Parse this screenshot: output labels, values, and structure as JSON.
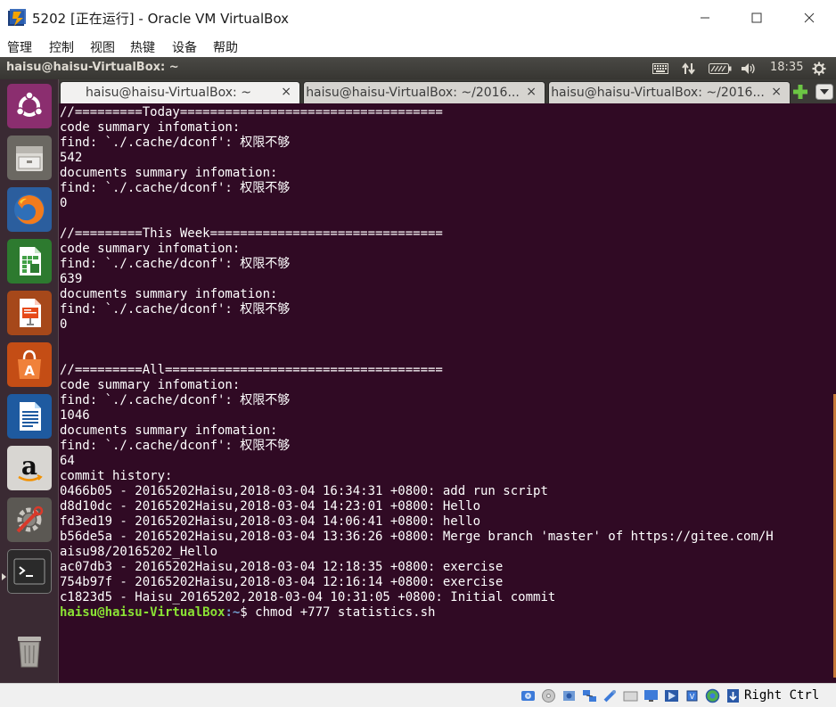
{
  "window": {
    "title": "5202 [正在运行] - Oracle VM VirtualBox",
    "minimize_glyph": "—",
    "maximize_glyph": "☐",
    "close_glyph": "✕"
  },
  "host_menu": [
    "管理",
    "控制",
    "视图",
    "热键",
    "设备",
    "帮助"
  ],
  "ubuntu_panel": {
    "title": "haisu@haisu-VirtualBox: ~",
    "clock": "18:35",
    "indicators": [
      "keyboard-icon",
      "network-transfer-icon",
      "battery-icon",
      "volume-icon",
      "power-gear-icon"
    ]
  },
  "launcher": {
    "items": [
      {
        "name": "ubuntu-dash-icon"
      },
      {
        "name": "files-icon"
      },
      {
        "name": "firefox-icon"
      },
      {
        "name": "libreoffice-calc-icon"
      },
      {
        "name": "libreoffice-impress-icon"
      },
      {
        "name": "software-center-icon"
      },
      {
        "name": "libreoffice-writer-icon"
      },
      {
        "name": "amazon-icon"
      },
      {
        "name": "system-settings-icon"
      },
      {
        "name": "terminal-icon"
      },
      {
        "name": "trash-icon"
      }
    ]
  },
  "tabs": [
    {
      "label": "haisu@haisu-VirtualBox: ~",
      "active": true
    },
    {
      "label": "haisu@haisu-VirtualBox: ~/2016...",
      "active": false
    },
    {
      "label": "haisu@haisu-VirtualBox: ~/2016...",
      "active": false
    }
  ],
  "tab_close_glyph": "×",
  "terminal": {
    "lines": [
      "//=========Today===================================",
      "code summary infomation:",
      "find: `./.cache/dconf': 权限不够",
      "542",
      "documents summary infomation:",
      "find: `./.cache/dconf': 权限不够",
      "0",
      "",
      "//=========This Week===============================",
      "code summary infomation:",
      "find: `./.cache/dconf': 权限不够",
      "639",
      "documents summary infomation:",
      "find: `./.cache/dconf': 权限不够",
      "0",
      "",
      "",
      "//=========All=====================================",
      "code summary infomation:",
      "find: `./.cache/dconf': 权限不够",
      "1046",
      "documents summary infomation:",
      "find: `./.cache/dconf': 权限不够",
      "64",
      "commit history:",
      "0466b05 - 20165202Haisu,2018-03-04 16:34:31 +0800: add run script",
      "d8d10dc - 20165202Haisu,2018-03-04 14:23:01 +0800: Hello",
      "fd3ed19 - 20165202Haisu,2018-03-04 14:06:41 +0800: hello",
      "b56de5a - 20165202Haisu,2018-03-04 13:36:26 +0800: Merge branch 'master' of https://gitee.com/H",
      "aisu98/20165202_Hello",
      "ac07db3 - 20165202Haisu,2018-03-04 12:18:35 +0800: exercise",
      "754b97f - 20165202Haisu,2018-03-04 12:16:14 +0800: exercise",
      "c1823d5 - Haisu_20165202,2018-03-04 10:31:05 +0800: Initial commit"
    ],
    "prompt": {
      "user_host": "haisu@haisu-VirtualBox",
      "path": ":~",
      "symbol": "$ ",
      "command": "chmod +777 statistics.sh"
    }
  },
  "statusbar": {
    "icons": [
      "hard-disk-icon",
      "optical-drive-icon",
      "audio-icon",
      "network-icon",
      "usb-icon",
      "shared-folder-icon",
      "display-icon",
      "video-capture-icon",
      "cpu-icon",
      "mouse-integration-icon",
      "keyboard-capture-icon"
    ],
    "host_key": "Right Ctrl"
  }
}
